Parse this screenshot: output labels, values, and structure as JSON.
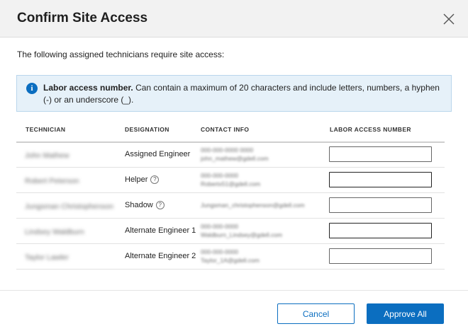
{
  "dialog": {
    "title": "Confirm Site Access",
    "intro": "The following assigned technicians require site access:"
  },
  "info_box": {
    "icon": "info-icon",
    "heading": "Labor access number.",
    "body": "Can contain a maximum of 20 characters and include letters, numbers, a hyphen (-) or an underscore (_)."
  },
  "table": {
    "headers": {
      "technician": "TECHNICIAN",
      "designation": "DESIGNATION",
      "contact": "CONTACT INFO",
      "access": "LABOR ACCESS NUMBER"
    },
    "rows": [
      {
        "name": "John Mathew",
        "designation": "Assigned Engineer",
        "has_help": false,
        "phone": "000-000-0000 0000",
        "email": "john_mathew@gdell.com",
        "access_value": ""
      },
      {
        "name": "Robert Peterson",
        "designation": "Helper",
        "has_help": true,
        "phone": "000-000-0000",
        "email": "Robertx51@gdell.com",
        "access_value": ""
      },
      {
        "name": "Jungsman Christophenson",
        "designation": "Shadow",
        "has_help": true,
        "phone": "",
        "email": "Jungsman_christophenson@gdell.com",
        "access_value": ""
      },
      {
        "name": "Lindsey Waldburn",
        "designation": "Alternate Engineer 1",
        "has_help": false,
        "phone": "000-000-0000",
        "email": "Waldburn_Lindsey@gdell.com",
        "access_value": ""
      },
      {
        "name": "Taylor Lawler",
        "designation": "Alternate Engineer 2",
        "has_help": false,
        "phone": "000-000-0000",
        "email": "Taylor_1A@gdell.com",
        "access_value": ""
      }
    ]
  },
  "footer": {
    "cancel_label": "Cancel",
    "approve_label": "Approve All"
  },
  "colors": {
    "accent": "#0b6ec0",
    "info_bg": "#e6f1f9",
    "header_bg": "#f2f2f2"
  }
}
